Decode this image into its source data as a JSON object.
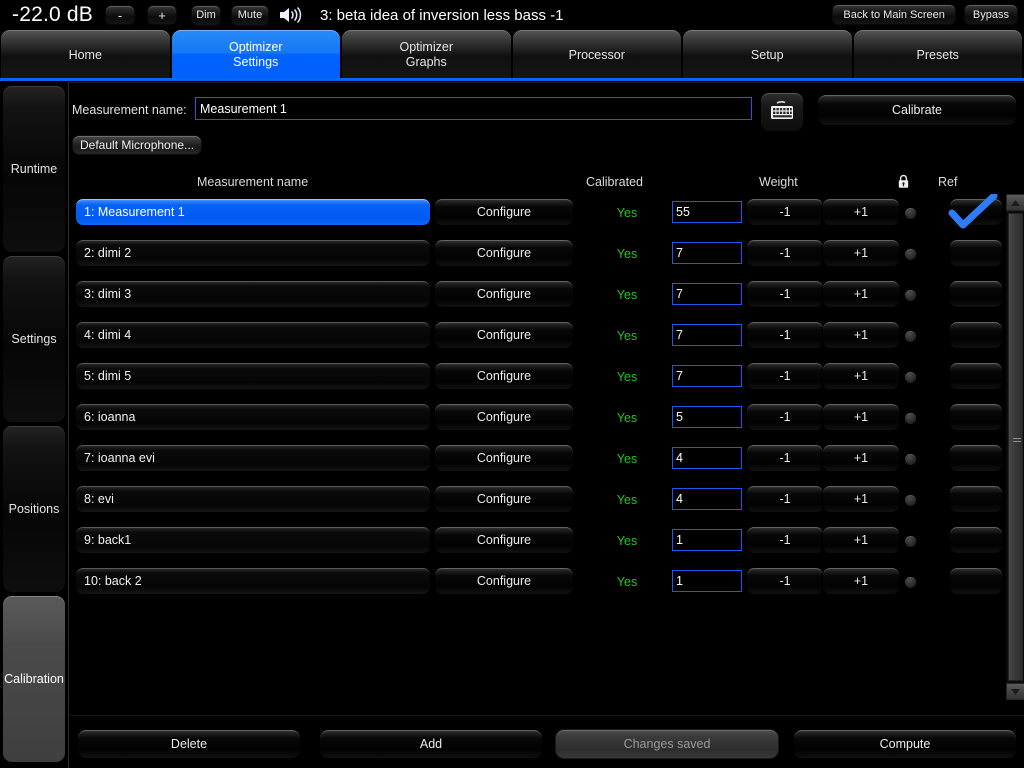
{
  "topbar": {
    "db_readout": "-22.0 dB",
    "minus_label": "-",
    "plus_label": "+",
    "dim_label": "Dim",
    "mute_label": "Mute",
    "speaker_icon": "speaker-volume-icon",
    "preset_title": "3: beta idea of inversion less bass -1",
    "back_label": "Back to Main Screen",
    "bypass_label": "Bypass"
  },
  "tabs": [
    {
      "line1": "Home",
      "line2": "",
      "active": false
    },
    {
      "line1": "Optimizer",
      "line2": "Settings",
      "active": true
    },
    {
      "line1": "Optimizer",
      "line2": "Graphs",
      "active": false
    },
    {
      "line1": "Processor",
      "line2": "",
      "active": false
    },
    {
      "line1": "Setup",
      "line2": "",
      "active": false
    },
    {
      "line1": "Presets",
      "line2": "",
      "active": false
    }
  ],
  "sidebar": {
    "items": [
      {
        "label": "Runtime",
        "active": false
      },
      {
        "label": "Settings",
        "active": false
      },
      {
        "label": "Positions",
        "active": false
      },
      {
        "label": "Calibration",
        "active": true
      }
    ]
  },
  "form": {
    "measurement_name_label": "Measurement name:",
    "measurement_name_value": "Measurement 1",
    "measurement_name_placeholder": "Measurement name",
    "keyboard_icon": "onscreen-keyboard-icon",
    "calibrate_label": "Calibrate",
    "default_microphone_label": "Default Microphone..."
  },
  "table": {
    "headers": {
      "name": "Measurement name",
      "calibrated": "Calibrated",
      "weight": "Weight",
      "lock_icon": "lock-icon",
      "ref": "Ref"
    },
    "configure_label": "Configure",
    "decrement_label": "-1",
    "increment_label": "+1",
    "rows": [
      {
        "name": "1: Measurement 1",
        "calibrated": "Yes",
        "weight": "55",
        "selected": true,
        "ref": true
      },
      {
        "name": "2: dimi 2",
        "calibrated": "Yes",
        "weight": "7",
        "selected": false,
        "ref": false
      },
      {
        "name": "3: dimi 3",
        "calibrated": "Yes",
        "weight": "7",
        "selected": false,
        "ref": false
      },
      {
        "name": "4: dimi 4",
        "calibrated": "Yes",
        "weight": "7",
        "selected": false,
        "ref": false
      },
      {
        "name": "5: dimi 5",
        "calibrated": "Yes",
        "weight": "7",
        "selected": false,
        "ref": false
      },
      {
        "name": "6: ioanna",
        "calibrated": "Yes",
        "weight": "5",
        "selected": false,
        "ref": false
      },
      {
        "name": "7: ioanna evi",
        "calibrated": "Yes",
        "weight": "4",
        "selected": false,
        "ref": false
      },
      {
        "name": "8: evi",
        "calibrated": "Yes",
        "weight": "4",
        "selected": false,
        "ref": false
      },
      {
        "name": "9: back1",
        "calibrated": "Yes",
        "weight": "1",
        "selected": false,
        "ref": false
      },
      {
        "name": "10: back 2",
        "calibrated": "Yes",
        "weight": "1",
        "selected": false,
        "ref": false
      }
    ]
  },
  "scrollbar": {
    "up_icon": "scroll-up-arrow-icon",
    "down_icon": "scroll-down-arrow-icon"
  },
  "footer": {
    "delete_label": "Delete",
    "add_label": "Add",
    "saved_label": "Changes saved",
    "compute_label": "Compute"
  },
  "colors": {
    "accent_blue": "#0062ff",
    "selected_row": "#0764f7",
    "calibrated_green": "#21c521",
    "input_border": "#2056f0",
    "background": "#000000"
  }
}
